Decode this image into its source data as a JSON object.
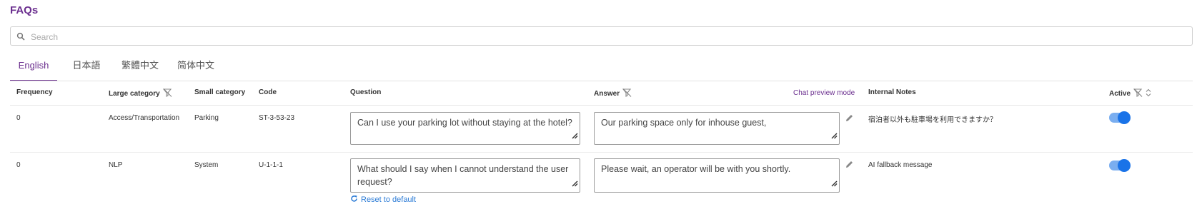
{
  "page": {
    "title": "FAQs"
  },
  "search": {
    "placeholder": "Search",
    "value": ""
  },
  "tabs": [
    {
      "label": "English",
      "active": true
    },
    {
      "label": "日本語",
      "active": false
    },
    {
      "label": "繁體中文",
      "active": false
    },
    {
      "label": "简体中文",
      "active": false
    }
  ],
  "columns": {
    "frequency": "Frequency",
    "large_category": "Large category",
    "small_category": "Small category",
    "code": "Code",
    "question": "Question",
    "answer": "Answer",
    "chat_preview": "Chat preview mode",
    "internal_notes": "Internal Notes",
    "active": "Active"
  },
  "rows": [
    {
      "frequency": "0",
      "large_category": "Access/Transportation",
      "small_category": "Parking",
      "code": "ST-3-53-23",
      "question": "Can I use your parking lot without staying at the hotel?",
      "answer": "Our parking space only for inhouse guest,",
      "internal_notes": "宿泊者以外も駐車場を利用できますか？",
      "active": true
    },
    {
      "frequency": "0",
      "large_category": "NLP",
      "small_category": "System",
      "code": "U-1-1-1",
      "question": "What should I say when I cannot understand the user request?",
      "answer": "Please wait, an operator will be with you shortly.",
      "internal_notes": "AI fallback message",
      "active": true,
      "reset_label": "Reset to default"
    }
  ],
  "colors": {
    "brand": "#6b2f8f",
    "link": "#2b7bd6",
    "toggle_on": "#1a73e8"
  },
  "icons": [
    "search-icon",
    "filter-off-icon",
    "sort-icon",
    "pencil-icon",
    "refresh-icon",
    "resize-grip-icon"
  ]
}
